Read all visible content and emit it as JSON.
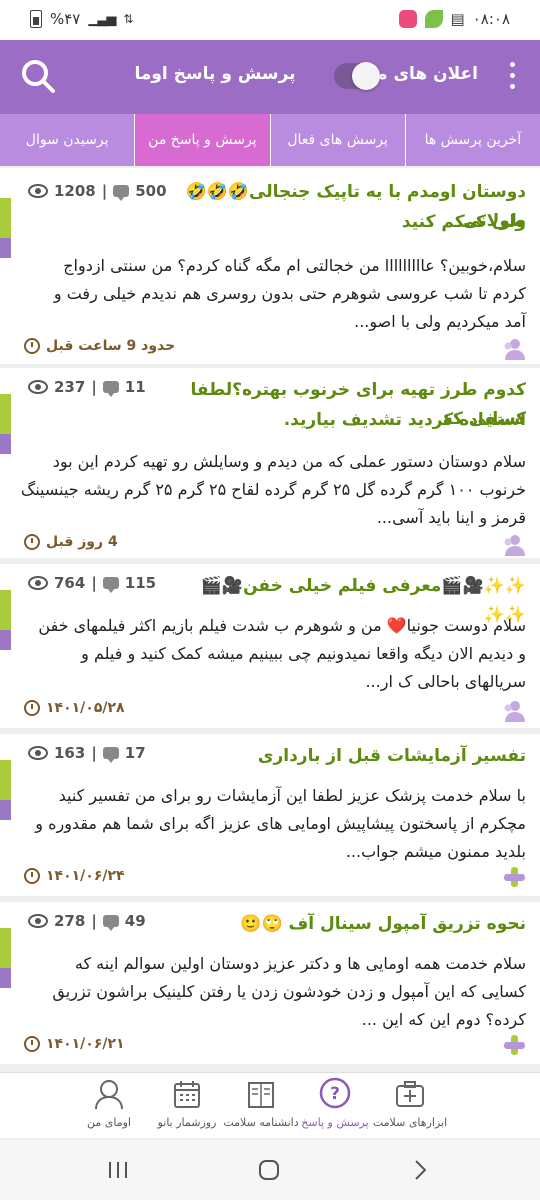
{
  "status": {
    "battery": "%۴۷",
    "time": "۰۸:۰۸"
  },
  "header": {
    "title": "پرسش و پاسخ اوما",
    "notifications_label": "اعلان های من"
  },
  "tabs": [
    {
      "label": "آخرین پرسش ها"
    },
    {
      "label": "پرسش های فعال"
    },
    {
      "label": "پرسش و پاسخ من",
      "active": true
    },
    {
      "label": "پرسیدن سوال"
    }
  ],
  "questions": [
    {
      "title": "دوستان اومدم با یه تاپیک جنجالی🤣🤣🤣طولانی",
      "title2": "ولی کمکم کنید",
      "comments": "500",
      "views": "1208",
      "body1": "سلام،خوبین؟ عااااااااا من خجالتی ام مگه گناه کردم؟ من سنتی ازدواج",
      "body2": "کردم تا شب عروسی شوهرم حتی بدون روسری هم ندیدم خیلی رفت و",
      "body3": "آمد میکردیم ولی با اصو...",
      "time": "حدود 9 ساعت قبل"
    },
    {
      "title": "کدوم طرز تهیه برای خرنوب بهتره؟لطفا کسایی که",
      "title2": "استفاده کردید تشدیف بیارید.",
      "comments": "11",
      "views": "237",
      "body1": "سلام دوستان دستور عملی که من دیدم و وسایلش رو تهیه کردم این بود",
      "body2": "خرنوب ۱۰۰ گرم گرده گل ۲۵ گرم گرده لقاح ۲۵ گرم ۲۵ گرم ریشه جینسینگ",
      "body3": "قرمز و اینا باید آسی...",
      "time": "4 روز قبل"
    },
    {
      "title": "✨✨🎥🎬معرفی فیلم خیلی خفن🎥🎬✨✨",
      "title2": "",
      "comments": "115",
      "views": "764",
      "body1": "سلام دوست جونیا❤️ من و شوهرم ب شدت فیلم بازیم اکثر فیلمهای خفن",
      "body2": "و دیدیم الان دیگه واقعا نمیدونیم چی ببینیم میشه کمک کنید و فیلم و",
      "body3": "سریالهای باحالی ک ار...",
      "time": "۱۴۰۱/۰۵/۲۸"
    },
    {
      "title": "تفسیر آزمایشات قبل از بارداری",
      "title2": "",
      "comments": "17",
      "views": "163",
      "body1": "با سلام خدمت پزشک عزیز لطفا این آزمایشات رو برای من تفسیر کنید",
      "body2": "مچکرم از پاسختون پیشاپیش اومایی های عزیز اگه برای شما هم مقدوره و",
      "body3": "بلدید ممنون میشم جواب...",
      "time": "۱۴۰۱/۰۶/۲۴"
    },
    {
      "title": "نحوه تزریق آمپول سینال آف 🙄🙂",
      "title2": "",
      "comments": "49",
      "views": "278",
      "body1": "سلام خدمت همه اومایی ها و دکتر عزیز  دوستان اولین سوالم اینه که",
      "body2": "کسایی که این آمپول و زدن خودشون زدن یا رفتن کلینیک براشون تزریق",
      "body3": "کرده؟  دوم این که این ...",
      "time": "۱۴۰۱/۰۶/۲۱"
    }
  ],
  "bottom_nav": [
    {
      "label": "ابزارهای سلامت"
    },
    {
      "label": "پرسش و پاسخ",
      "active": true
    },
    {
      "label": "دانشنامه سلامت"
    },
    {
      "label": "روزشمار بانو"
    },
    {
      "label": "اومای من"
    }
  ]
}
